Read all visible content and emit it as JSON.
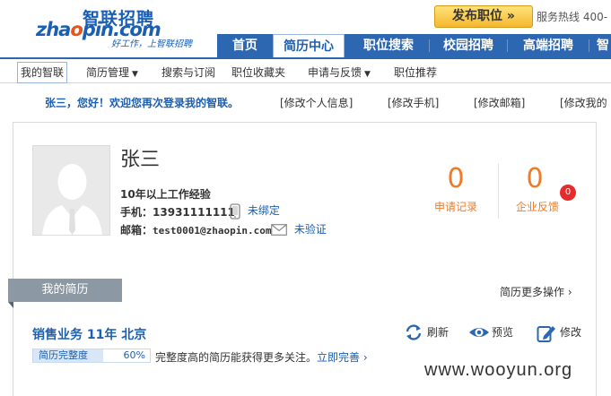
{
  "brand": {
    "name_cn": "智联招聘",
    "name_en_pre": "zha",
    "name_en_o": "o",
    "name_en_post": "pin.com",
    "slogan": "好工作，上智联招聘"
  },
  "header": {
    "post_job": "发布职位 »",
    "hotline": "服务热线  400-"
  },
  "main_nav": [
    "首页",
    "简历中心",
    "职位搜索",
    "校园招聘",
    "高端招聘",
    "智"
  ],
  "sub_nav": {
    "my_zhilian": "我的智联",
    "resume_manage": "简历管理",
    "search_subscribe": "搜索与订阅",
    "job_favorites": "职位收藏夹",
    "apply_feedback": "申请与反馈",
    "job_recommend": "职位推荐"
  },
  "welcome": {
    "greeting": "张三，您好！欢迎您再次登录我的智联。",
    "links": [
      "[修改个人信息]",
      "[修改手机]",
      "[修改邮箱]",
      "[修改我的"
    ]
  },
  "profile": {
    "name": "张三",
    "experience": "10年以上工作经验",
    "phone_label": "手机：",
    "phone": "13931111111",
    "phone_status": "未绑定",
    "email_label": "邮箱：",
    "email": "test0001@zhaopin.com",
    "email_status": "未验证"
  },
  "stats": {
    "applications_count": "0",
    "applications_label": "申请记录",
    "feedback_count": "0",
    "feedback_label": "企业反馈",
    "feedback_badge": "0"
  },
  "resume": {
    "tab_label": "我的简历",
    "more_ops": "简历更多操作 ›",
    "title": "销售业务  11年  北京",
    "actions": {
      "refresh": "刷新",
      "preview": "预览",
      "edit": "修改"
    },
    "completeness_label": "简历完整度",
    "completeness_pct": "60%",
    "completeness_value": 0.6,
    "tip": "完整度高的简历能获得更多关注。",
    "tip_link": "立即完善 ›"
  },
  "colors": {
    "brand_blue": "#2e67b1",
    "accent_orange": "#f07a25",
    "badge_red": "#e52b2b"
  },
  "watermark": "www.wooyun.org"
}
